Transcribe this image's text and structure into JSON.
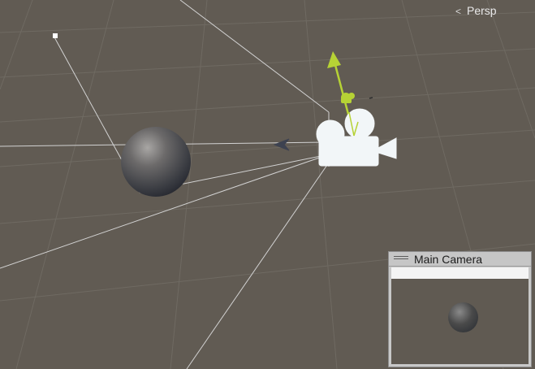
{
  "scene_view": {
    "projection_label": "Persp",
    "icons": [
      "persp-chevron-icon",
      "camera-gizmo-icon",
      "sun-light-icon",
      "y-axis-arrow-icon",
      "forward-arrow-icon"
    ],
    "colors": {
      "background": "#615b53",
      "grid": "#6f6a62",
      "frustum": "#cfcfcf",
      "gizmo_y_axis": "#b6d235",
      "camera_icon": "#f2f6f8"
    }
  },
  "camera_preview": {
    "title": "Main Camera"
  }
}
